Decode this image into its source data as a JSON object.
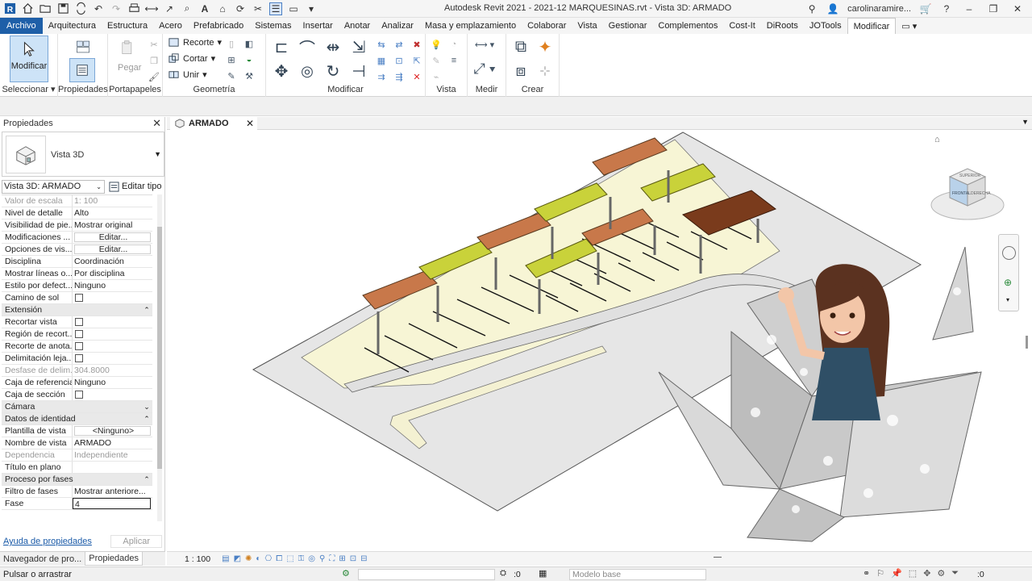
{
  "window": {
    "title": "Autodesk Revit 2021 - 2021-12 MARQUESINAS.rvt - Vista 3D: ARMADO",
    "user": "carolinaramire..."
  },
  "ribbon_tabs": [
    "Archivo",
    "Arquitectura",
    "Estructura",
    "Acero",
    "Prefabricado",
    "Sistemas",
    "Insertar",
    "Anotar",
    "Analizar",
    "Masa y emplazamiento",
    "Colaborar",
    "Vista",
    "Gestionar",
    "Complementos",
    "Cost-It",
    "DiRoots",
    "JOTools",
    "Modificar"
  ],
  "ribbon": {
    "modify_label": "Modificar",
    "paste_label": "Pegar",
    "cope_label": "Recorte",
    "cut_label": "Cortar",
    "join_label": "Unir",
    "panels": {
      "select": "Seleccionar",
      "properties": "Propiedades",
      "clipboard": "Portapapeles",
      "geometry": "Geometría",
      "modify": "Modificar",
      "view": "Vista",
      "measure": "Medir",
      "create": "Crear"
    }
  },
  "properties": {
    "header": "Propiedades",
    "type_name": "Vista 3D",
    "view_selector": "Vista 3D: ARMADO",
    "edit_type": "Editar tipo",
    "rows": [
      {
        "k": "Valor de escala",
        "v": "1:  100",
        "dis": true
      },
      {
        "k": "Nivel de detalle",
        "v": "Alto"
      },
      {
        "k": "Visibilidad de pie...",
        "v": "Mostrar original"
      },
      {
        "k": "Modificaciones ...",
        "v": "Editar...",
        "btn": true
      },
      {
        "k": "Opciones de vis...",
        "v": "Editar...",
        "btn": true
      },
      {
        "k": "Disciplina",
        "v": "Coordinación"
      },
      {
        "k": "Mostrar líneas o...",
        "v": "Por disciplina"
      },
      {
        "k": "Estilo por defect...",
        "v": "Ninguno"
      },
      {
        "k": "Camino de sol",
        "v": "",
        "cb": true
      },
      {
        "group": "Extensión",
        "tog": "⌃"
      },
      {
        "k": "Recortar vista",
        "v": "",
        "cb": true
      },
      {
        "k": "Región de recort...",
        "v": "",
        "cb": true
      },
      {
        "k": "Recorte de anota...",
        "v": "",
        "cb": true
      },
      {
        "k": "Delimitación leja...",
        "v": "",
        "cb": true
      },
      {
        "k": "Desfase de delim...",
        "v": "304.8000",
        "dis": true
      },
      {
        "k": "Caja de referencia",
        "v": "Ninguno"
      },
      {
        "k": "Caja de sección",
        "v": "",
        "cb": true
      },
      {
        "group": "Cámara",
        "tog": "⌄"
      },
      {
        "group": "Datos de identidad",
        "tog": "⌃"
      },
      {
        "k": "Plantilla de vista",
        "v": "<Ninguno>",
        "btn": true
      },
      {
        "k": "Nombre de vista",
        "v": "ARMADO"
      },
      {
        "k": "Dependencia",
        "v": "Independiente",
        "dis": true
      },
      {
        "k": "Título en plano",
        "v": ""
      },
      {
        "group": "Proceso por fases",
        "tog": "⌃"
      },
      {
        "k": "Filtro de fases",
        "v": "Mostrar anteriore..."
      },
      {
        "k": "Fase",
        "v": "4",
        "sel": true
      }
    ],
    "help": "Ayuda de propiedades",
    "apply": "Aplicar"
  },
  "bottom_tabs": [
    "Navegador de pro...",
    "Propiedades"
  ],
  "view_tab": "ARMADO",
  "view_scale": "1 : 100",
  "viewcube": {
    "top": "SUPERIOR",
    "front": "FRONTAL",
    "right": "DERECHA"
  },
  "status": {
    "text": "Pulsar o arrastrar",
    "zero_left": ":0",
    "model": "Modelo base",
    "zero_right": ":0"
  },
  "colors": {
    "file_tab": "#1e5fa8",
    "roof_orange": "#c8784a",
    "roof_yellow": "#c9d23a",
    "roof_brown": "#7a3b1c",
    "pad": "#f7f5d5"
  }
}
